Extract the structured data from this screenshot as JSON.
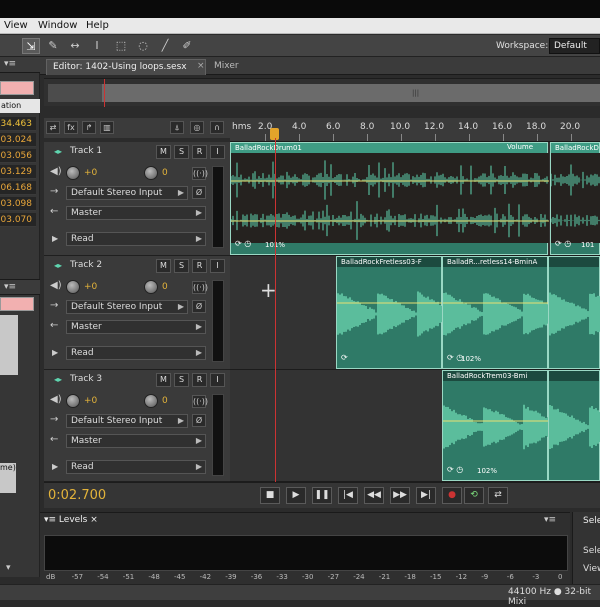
{
  "menu": {
    "view": "View",
    "window": "Window",
    "help": "Help"
  },
  "toolbar": {
    "workspace_label": "Workspace:",
    "workspace_value": "Default"
  },
  "left_panel": {
    "header": "ation",
    "values": [
      "34.463",
      "03.024",
      "03.056",
      "03.129",
      "06.168",
      "03.098",
      "03.070"
    ],
    "lower_label": "me)"
  },
  "editor": {
    "tab_label": "Editor: 1402-Using loops.sesx",
    "tab_close": "×",
    "tab_mixer": "Mixer"
  },
  "ruler": {
    "unit": "hms",
    "ticks": [
      "2.0",
      "4.0",
      "6.0",
      "8.0",
      "10.0",
      "12.0",
      "14.0",
      "16.0",
      "18.0",
      "20.0"
    ]
  },
  "tracks": [
    {
      "name": "Track 1",
      "volume": "+0",
      "input": "Default Stereo Input",
      "output": "Master",
      "mode": "Read"
    },
    {
      "name": "Track 2",
      "volume": "+0",
      "input": "Default Stereo Input",
      "output": "Master",
      "mode": "Read"
    },
    {
      "name": "Track 3",
      "volume": "+0",
      "input": "Default Stereo Input",
      "output": "Master",
      "mode": "Read"
    }
  ],
  "clips": {
    "t1_a": "BalladRockDrum01",
    "t1_a_vol": "Volume",
    "t1_b": "BalladRockDru",
    "t1_pct": "101%",
    "t1_pct2": "101",
    "t2_a": "BalladRockFretless03-F",
    "t2_b": "BalladR...retless14-BminA",
    "t2_pct": "102%",
    "t3_a": "BalladRockTrem03-Bmi",
    "t3_pct": "102%"
  },
  "transport": {
    "time": "0:02.700"
  },
  "levels": {
    "tab": "Levels",
    "scale": [
      "dB",
      "-57",
      "-54",
      "-51",
      "-48",
      "-45",
      "-42",
      "-39",
      "-36",
      "-33",
      "-30",
      "-27",
      "-24",
      "-21",
      "-18",
      "-15",
      "-12",
      "-9",
      "-6",
      "-3",
      "0"
    ]
  },
  "select_panel": {
    "tab": "Sele",
    "label1": "Sele",
    "label2": "View"
  },
  "status": {
    "text": "44100 Hz ● 32-bit Mixi"
  },
  "colors": {
    "accent": "#e3b33a",
    "waveform": "#5fd6b0",
    "clip_bg": "#2f7a67",
    "playhead": "#cc3333"
  }
}
